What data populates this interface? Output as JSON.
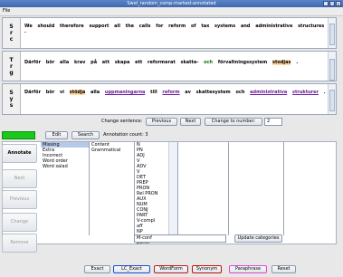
{
  "window": {
    "title": "Swel_random_comp-marked-annotated"
  },
  "menu": {
    "file": "File"
  },
  "panels": {
    "source": {
      "lang": [
        "S",
        "r",
        "c"
      ],
      "sentence": "We should therefore support all the calls for reform of tax systems and administrative structures ."
    },
    "target": {
      "lang": [
        "T",
        "r",
        "g"
      ],
      "pre": "Därför bör alla krav på att skapa ett reformerat skatte- ",
      "och": "och",
      "mid": " förvaltningssystem ",
      "stodjas": "stodjas",
      "post": " ."
    },
    "system": {
      "lang": [
        "S",
        "y",
        "s"
      ],
      "pre": "Därför bör vi ",
      "stodja": "stödja",
      "mid1": " alla ",
      "uppmaningarna": "uppmaningarna",
      "mid2": " till ",
      "reform": "reform",
      "mid3": " av skattesystem och ",
      "administrativa": "administrativa",
      "mid4": " ",
      "strukturer": "strukturer",
      "post": " ."
    }
  },
  "nav": {
    "change_sentence": "Change sentence:",
    "previous": "Previous",
    "next": "Next",
    "change_to_number": "Change to number:",
    "number_value": "2"
  },
  "toolbar": {
    "edit": "Edit",
    "search": "Search",
    "annotation_count": "Annotation count: 3"
  },
  "side_buttons": {
    "annotate": "Annotate",
    "next": "Next",
    "previous": "Previous",
    "change": "Change",
    "remove": "Remove"
  },
  "lists": {
    "category": [
      "Missing",
      "Extra",
      "Incorrect",
      "Word order",
      "Word salad"
    ],
    "subcategory": [
      "Content",
      "Grammatical"
    ],
    "pos": [
      "N",
      "PN",
      "ADJ",
      "V",
      "ADV",
      "V",
      "DET",
      "PREP",
      "PRON",
      "Rel PRON",
      "AUX",
      "NUM",
      "CONJ",
      "PART",
      "V-compl",
      "aff",
      "NP",
      "multi",
      "punct"
    ]
  },
  "bottom": {
    "field_value": "M-conf",
    "update_categories": "Update categories"
  },
  "matching_buttons": {
    "exact": "Exact",
    "lc_exact": "LC_Exact",
    "wordform": "WordForm",
    "synonym": "Synonym",
    "paraphrase": "Paraphrase",
    "reset": "Reset"
  },
  "colors": {
    "title_bar": "#4a76bd",
    "annotate_marker": "#19c919",
    "lc_exact_border": "#1f4ad0",
    "wordform_border": "#b81e1e",
    "synonym_border": "#c01010",
    "paraphrase_border": "#d84ad8"
  }
}
